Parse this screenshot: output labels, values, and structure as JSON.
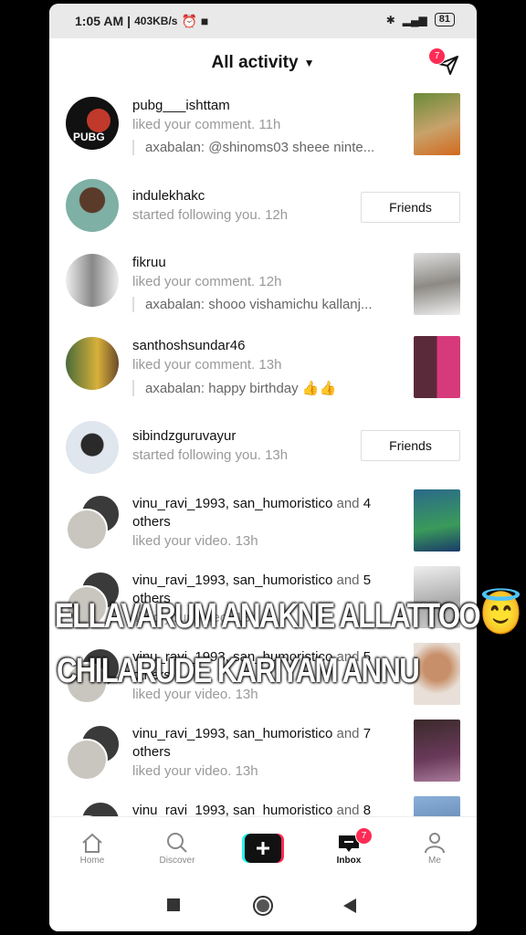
{
  "status": {
    "time": "1:05 AM",
    "speed": "403KB/s",
    "battery": "81"
  },
  "header": {
    "title": "All activity",
    "send_badge": "7"
  },
  "rows": [
    {
      "user": "pubg___ishttam",
      "action": "liked your comment.",
      "time": "11h",
      "quote": "axabalan: @shinoms03 sheee ninte..."
    },
    {
      "user": "indulekhakc",
      "action": "started following you.",
      "time": "12h",
      "button": "Friends"
    },
    {
      "user": "fikruu",
      "action": "liked your comment.",
      "time": "12h",
      "quote": "axabalan: shooo vishamichu kallanj..."
    },
    {
      "user": "santhoshsundar46",
      "action": "liked your comment.",
      "time": "13h",
      "quote": "axabalan: happy birthday 👍👍"
    },
    {
      "user": "sibindzguruvayur",
      "action": "started following you.",
      "time": "13h",
      "button": "Friends"
    },
    {
      "user1": "vinu_ravi_1993",
      "user2": "san_humoristico",
      "and": "and",
      "count": "4",
      "others": "others",
      "action": "liked your video.",
      "time": "13h"
    },
    {
      "user1": "vinu_ravi_1993",
      "user2": "san_humoristico",
      "and": "and",
      "count": "5",
      "others": "others",
      "action": "liked your video.",
      "time": "13h"
    },
    {
      "user1": "vinu_ravi_1993",
      "user2": "san_humoristico",
      "and": "and",
      "count": "5",
      "others": "others",
      "action": "liked your video.",
      "time": "13h"
    },
    {
      "user1": "vinu_ravi_1993",
      "user2": "san_humoristico",
      "and": "and",
      "count": "7",
      "others": "others",
      "action": "liked your video.",
      "time": "13h"
    },
    {
      "user1": "vinu_ravi_1993",
      "user2": "san_humoristico",
      "and": "and",
      "count": "8"
    }
  ],
  "overlay": {
    "line1": "ELLAVARUM ANAKNE ALLATTOO",
    "emoji": "😇",
    "line2": "CHILARUDE KARIYAM ANNU"
  },
  "tabs": {
    "home": "Home",
    "discover": "Discover",
    "inbox": "Inbox",
    "inbox_badge": "7",
    "me": "Me"
  }
}
